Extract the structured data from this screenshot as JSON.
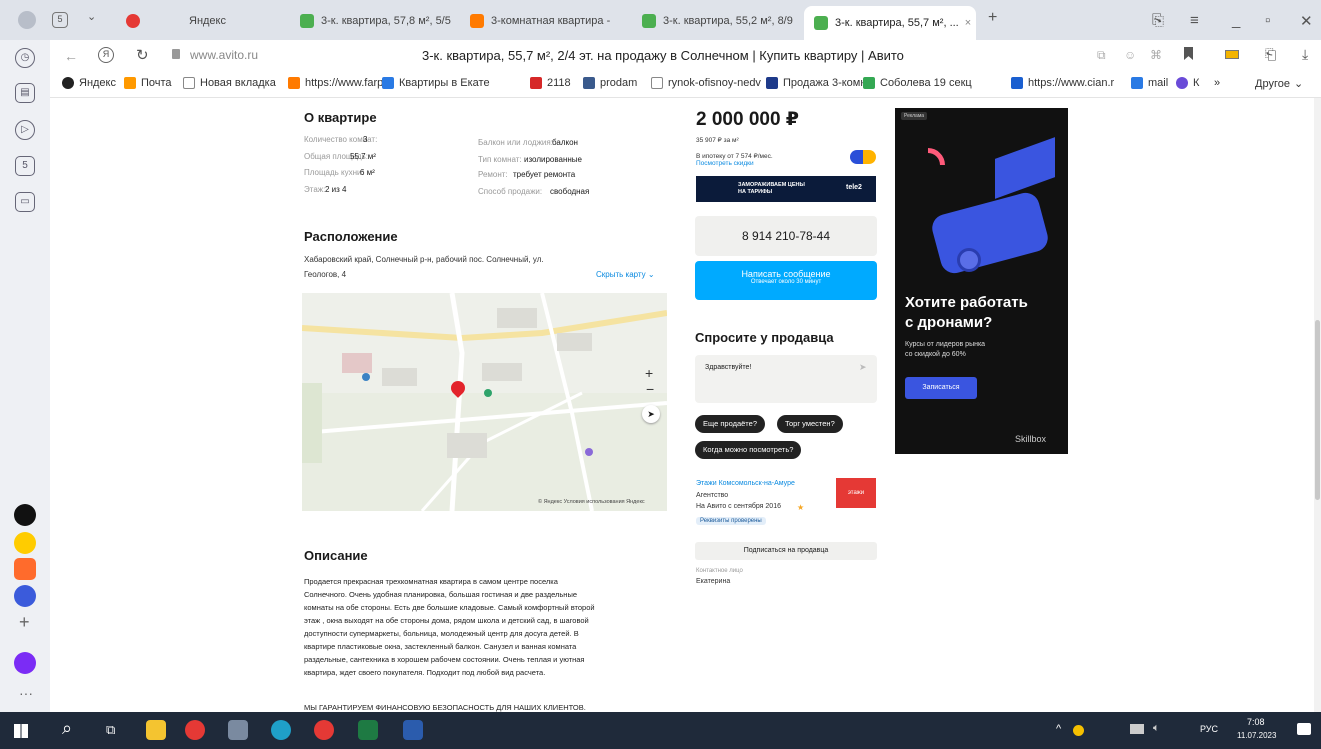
{
  "browser": {
    "tabs": [
      {
        "label": "Яндекс",
        "color": "#e53935"
      },
      {
        "label": "3-к. квартира, 57,8 м², 5/5",
        "color": "#4caf50"
      },
      {
        "label": "3-комнатная квартира -",
        "color": "#ff7a00"
      },
      {
        "label": "3-к. квартира, 55,2 м², 8/9",
        "color": "#4caf50"
      },
      {
        "label": "3-к. квартира, 55,7 м², ...",
        "color": "#4caf50"
      }
    ],
    "address": "www.avito.ru",
    "page_title": "3-к. квартира, 55,7 м², 2/4 эт. на продажу в Солнечном | Купить квартиру | Авито",
    "bookmarks": [
      {
        "label": "Яндекс",
        "color": "#222"
      },
      {
        "label": "Почта",
        "color": "#ff9900"
      },
      {
        "label": "Новая вкладка",
        "color": "#999"
      },
      {
        "label": "https://www.farpo",
        "color": "#ff7a00"
      },
      {
        "label": "Квартиры в Екате",
        "color": "#2a7ae4"
      },
      {
        "label": "2118",
        "color": "#d62828"
      },
      {
        "label": "prodam",
        "color": "#3a5a8c"
      },
      {
        "label": "rynok-ofisnoy-nedv",
        "color": "#999"
      },
      {
        "label": "Продажа 3-комна",
        "color": "#1e3a8a"
      },
      {
        "label": "Соболева 19 секц",
        "color": "#34a853"
      },
      {
        "label": "https://www.cian.r",
        "color": "#1a5fd0"
      },
      {
        "label": "mail",
        "color": "#2a7ae4"
      },
      {
        "label": "К",
        "color": "#6a4bd8"
      },
      {
        "label": "»",
        "color": "#555"
      }
    ],
    "other_label": "Другое"
  },
  "about": {
    "title": "О квартире",
    "left": [
      {
        "k": "Количество комнат:",
        "v": "3"
      },
      {
        "k": "Общая площадь:",
        "v": "55.7 м²"
      },
      {
        "k": "Площадь кухни:",
        "v": "6 м²"
      },
      {
        "k": "Этаж:",
        "v": "2 из 4"
      }
    ],
    "right": [
      {
        "k": "Балкон или лоджия:",
        "v": "балкон"
      },
      {
        "k": "Тип комнат:",
        "v": "изолированные"
      },
      {
        "k": "Ремонт:",
        "v": "требует ремонта"
      },
      {
        "k": "Способ продажи:",
        "v": "свободная"
      }
    ]
  },
  "location": {
    "title": "Расположение",
    "address_line1": "Хабаровский край, Солнечный р-н, рабочий пос. Солнечный, ул.",
    "address_line2": "Геологов, 4",
    "hide_map": "Скрыть карту",
    "map_zoom_in": "+",
    "map_zoom_out": "−",
    "map_footer": "© Яндекс Условия использования Яндекс"
  },
  "description": {
    "title": "Описание",
    "lines": [
      "Продается прекрасная трехкомнатная квартира в самом центре поселка",
      "Солнечного. Очень удобная планировка, большая гостиная и две раздельные",
      "комнаты на обе стороны. Есть две большие кладовые. Самый комфортный второй",
      "этаж , окна выходят на обе стороны дома, рядом школа и детский сад, в шаговой",
      "доступности супермаркеты, больница, молодежный центр для досуга детей. В",
      "квартире пластиковые окна, застекленный балкон. Санузел и ванная комната",
      "раздельные, сантехника в хорошем рабочем состоянии. Очень теплая и уютная",
      "квартира, ждет своего покупателя. Подходит под любой вид расчета."
    ],
    "guarantee": "МЫ ГАРАНТИРУЕМ ФИНАНСОВУЮ БЕЗОПАСНОСТЬ ДЛЯ НАШИХ КЛИЕНТОВ."
  },
  "price": {
    "value": "2 000 000 ₽",
    "per_m2": "35 907 ₽ за м²",
    "mortgage": "В ипотеку от 7 574 ₽/мес.",
    "mortgage_link": "Посмотреть скидки",
    "banner_text": "ЗАМОРАЖИВАЕМ ЦЕНЫ НА ТАРИФЫ",
    "banner_brand": "tele2",
    "phone": "8 914 210-78-44",
    "message_btn": "Написать сообщение",
    "message_sub": "Отвечает около 30 минут"
  },
  "ask": {
    "title": "Спросите у продавца",
    "input_value": "Здравствуйте!",
    "chips": [
      "Еще продаёте?",
      "Торг уместен?",
      "Когда можно посмотреть?"
    ]
  },
  "seller": {
    "name": "Этажи Комсомольск-на-Амуре",
    "type": "Агентство",
    "since": "На Авито с сентября 2016",
    "verified": "Реквизиты проверены",
    "logo_text": "этажи",
    "subscribe": "Подписаться на продавца",
    "contact_label": "Контактное лицо",
    "contact_name": "Екатерина"
  },
  "ad": {
    "tag": "Реклама",
    "headline1": "Хотите работать",
    "headline2": "с дронами?",
    "sub1": "Курсы от лидеров рынка",
    "sub2": "со скидкой до 60%",
    "cta": "Записаться",
    "brand": "Skillbox"
  },
  "taskbar": {
    "lang": "РУС",
    "time": "7:08",
    "date": "11.07.2023"
  },
  "colors": {
    "accent_blue": "#00aaff",
    "chip_dark": "#222222",
    "ad_bg": "#111111",
    "taskbar": "#1f2a3a"
  }
}
